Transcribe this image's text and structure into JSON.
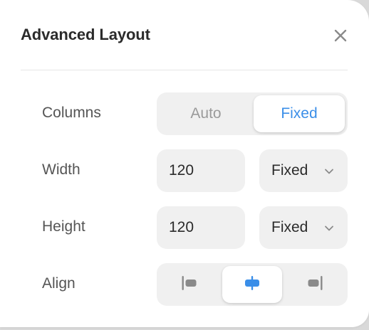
{
  "dialog": {
    "title": "Advanced Layout",
    "close_icon": "close-icon"
  },
  "columns": {
    "label": "Columns",
    "options": [
      "Auto",
      "Fixed"
    ],
    "selected": "Fixed"
  },
  "width": {
    "label": "Width",
    "value": "120",
    "mode": "Fixed",
    "mode_icon": "chevron-down-icon"
  },
  "height": {
    "label": "Height",
    "value": "120",
    "mode": "Fixed",
    "mode_icon": "chevron-down-icon"
  },
  "align": {
    "label": "Align",
    "options": [
      "align-left-icon",
      "align-center-icon",
      "align-right-icon"
    ],
    "selected": "align-center-icon"
  },
  "colors": {
    "accent": "#3a8ee8",
    "label_text": "#555555",
    "muted_text": "#9a9a9a",
    "control_bg": "#f0f0f0",
    "icon_gray": "#8a8a8a"
  }
}
